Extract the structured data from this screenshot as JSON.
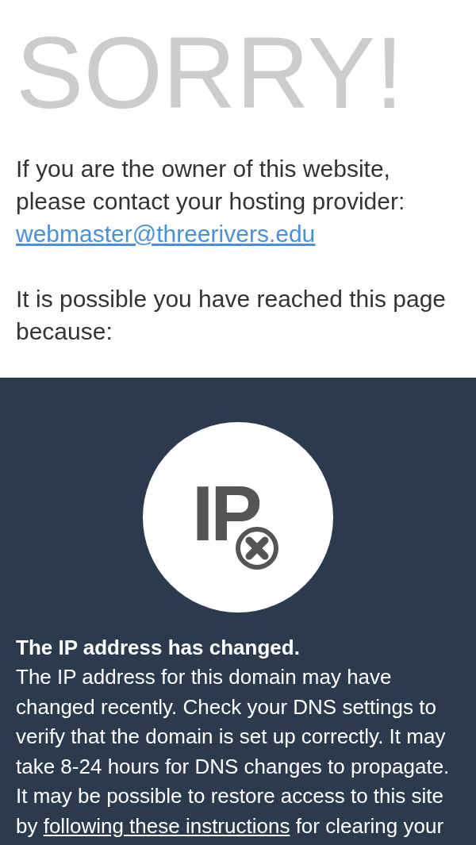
{
  "headline": "SORRY!",
  "intro": "If you are the owner of this website, please contact your hosting provider:",
  "contact_link": "webmaster@threerivers.edu",
  "reason_lead": "It is possible you have reached this page because:",
  "reason": {
    "icon_text": "IP",
    "title": "The IP address has changed.",
    "body_before": "The IP address for this domain may have changed recently. Check your DNS settings to verify that the domain is set up correctly. It may take 8-24 hours for DNS changes to propagate. It may be possible to restore access to this site by ",
    "body_link": "following these instructions",
    "body_after": " for clearing your"
  }
}
